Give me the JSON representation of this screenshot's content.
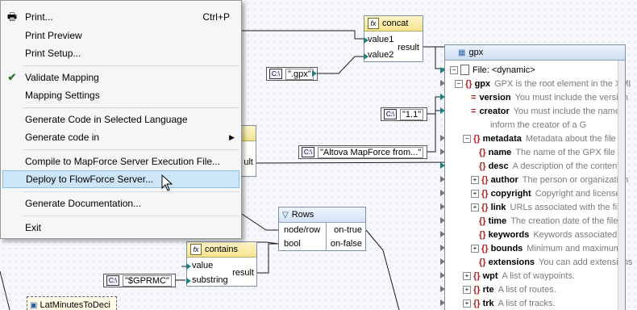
{
  "menu": {
    "items": [
      {
        "label": "Print...",
        "shortcut": "Ctrl+P",
        "icon": "printer-icon"
      },
      {
        "label": "Print Preview"
      },
      {
        "label": "Print Setup..."
      },
      {
        "label": "Validate Mapping",
        "icon": "validate-icon"
      },
      {
        "label": "Mapping Settings"
      },
      {
        "label": "Generate Code in Selected Language"
      },
      {
        "label": "Generate code in",
        "submenu": "▶"
      },
      {
        "label": "Compile to MapForce Server Execution File..."
      },
      {
        "label": "Deploy to FlowForce Server...",
        "highlighted": true
      },
      {
        "label": "Generate Documentation..."
      },
      {
        "label": "Exit"
      }
    ]
  },
  "concat": {
    "title": "concat",
    "in1": "value1",
    "in2": "value2",
    "out": "result"
  },
  "contains": {
    "title": "contains",
    "in1": "value",
    "in2": "substring",
    "out": "result"
  },
  "rows": {
    "title": "Rows",
    "in1": "node/row",
    "in2": "bool",
    "out1": "on-true",
    "out2": "on-false"
  },
  "constants": {
    "gpx_ext": "\".gpx\"",
    "version": "\"1.1\"",
    "creator": "\"Altova MapForce from...\"",
    "gprmc": "\"$GPRMC\"",
    "icon_text": "C:\\"
  },
  "partial_output": "ult",
  "lat_component": "LatMinutesToDeci",
  "gpx": {
    "title": "gpx",
    "file": "File: <dynamic>",
    "rows": [
      {
        "kind": "elem",
        "name": "gpx",
        "desc": "GPX is the root element in the XML"
      },
      {
        "kind": "attr",
        "name": "version",
        "desc": "You must include the version"
      },
      {
        "kind": "attr",
        "name": "creator",
        "desc": "You must include the name"
      },
      {
        "kind": "cont",
        "desc": "inform the creator of a G"
      },
      {
        "kind": "elem",
        "name": "metadata",
        "desc": "Metadata about the file"
      },
      {
        "kind": "elem",
        "name": "name",
        "desc": "The name of the GPX file"
      },
      {
        "kind": "elem",
        "name": "desc",
        "desc": "A description of the content"
      },
      {
        "kind": "elem",
        "name": "author",
        "desc": "The person or organization"
      },
      {
        "kind": "elem",
        "name": "copyright",
        "desc": "Copyright and license"
      },
      {
        "kind": "elem",
        "name": "link",
        "desc": "URLs associated with the file"
      },
      {
        "kind": "elem",
        "name": "time",
        "desc": "The creation date of the file"
      },
      {
        "kind": "elem",
        "name": "keywords",
        "desc": "Keywords associated"
      },
      {
        "kind": "elem",
        "name": "bounds",
        "desc": "Minimum and maximum"
      },
      {
        "kind": "elem",
        "name": "extensions",
        "desc": "You can add extensions"
      },
      {
        "kind": "elem",
        "name": "wpt",
        "desc": "A list of waypoints."
      },
      {
        "kind": "elem",
        "name": "rte",
        "desc": "A list of routes."
      },
      {
        "kind": "elem",
        "name": "trk",
        "desc": "A list of tracks."
      }
    ]
  },
  "colors": {
    "connector": "#1a8080",
    "highlight": "#cde6f7",
    "attribute": "#b02020"
  }
}
